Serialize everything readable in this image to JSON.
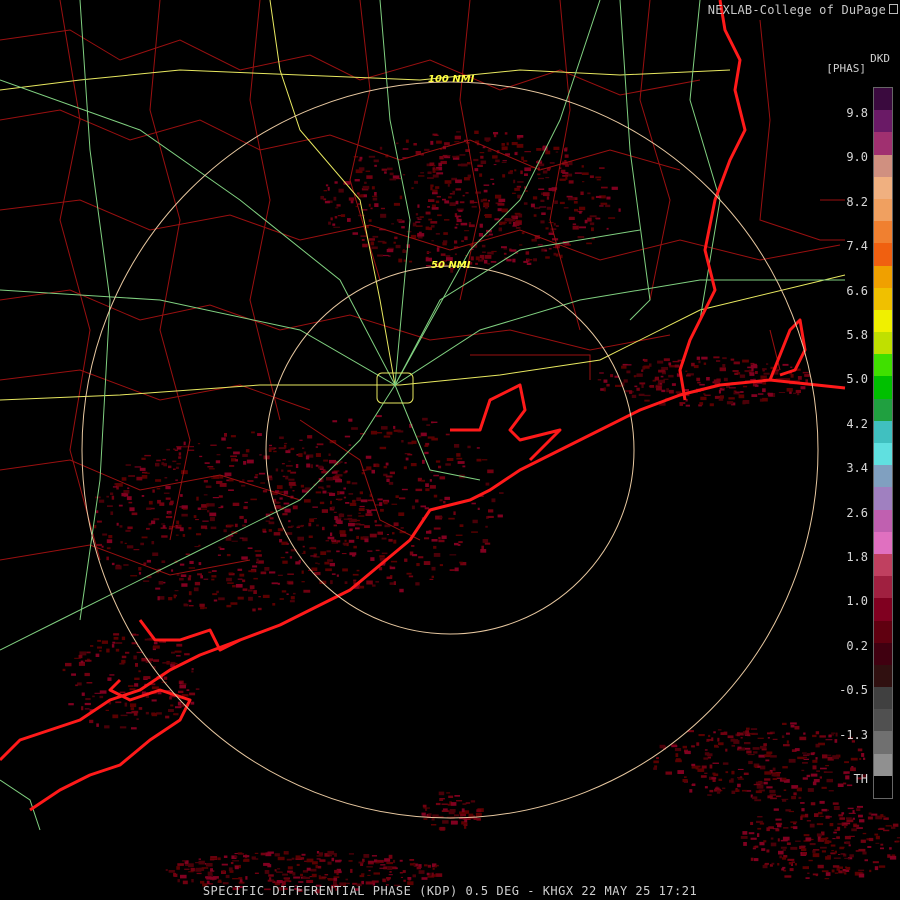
{
  "header": {
    "credit": "NEXLAB-College of DuPage"
  },
  "legend": {
    "product_code": "DKD",
    "units": "[PHAS]",
    "labels": [
      "9.8",
      "9.0",
      "8.2",
      "7.4",
      "6.6",
      "5.8",
      "5.0",
      "4.2",
      "3.4",
      "2.6",
      "1.8",
      "1.0",
      "0.2",
      "-0.5",
      "-1.3",
      "TH"
    ],
    "colors": [
      "#3a0a3e",
      "#6a1a66",
      "#a03070",
      "#d09080",
      "#f0b080",
      "#f0a060",
      "#f08030",
      "#f06010",
      "#f0a000",
      "#f0c000",
      "#f0f000",
      "#c0e000",
      "#40e000",
      "#00c000",
      "#20a040",
      "#40c0c0",
      "#60e0e0",
      "#80a0c0",
      "#a080c0",
      "#c060b0",
      "#e070c0",
      "#c04060",
      "#a02040",
      "#800020",
      "#600010",
      "#400010",
      "#301010",
      "#404040",
      "#505050",
      "#707070",
      "#909090",
      "#000000"
    ]
  },
  "map": {
    "range_rings": [
      "100 NMI",
      "50 NMI"
    ]
  },
  "footer": {
    "caption": "SPECIFIC DIFFERENTIAL PHASE (KDP) 0.5 DEG - KHGX 22 MAY 25 17:21"
  }
}
